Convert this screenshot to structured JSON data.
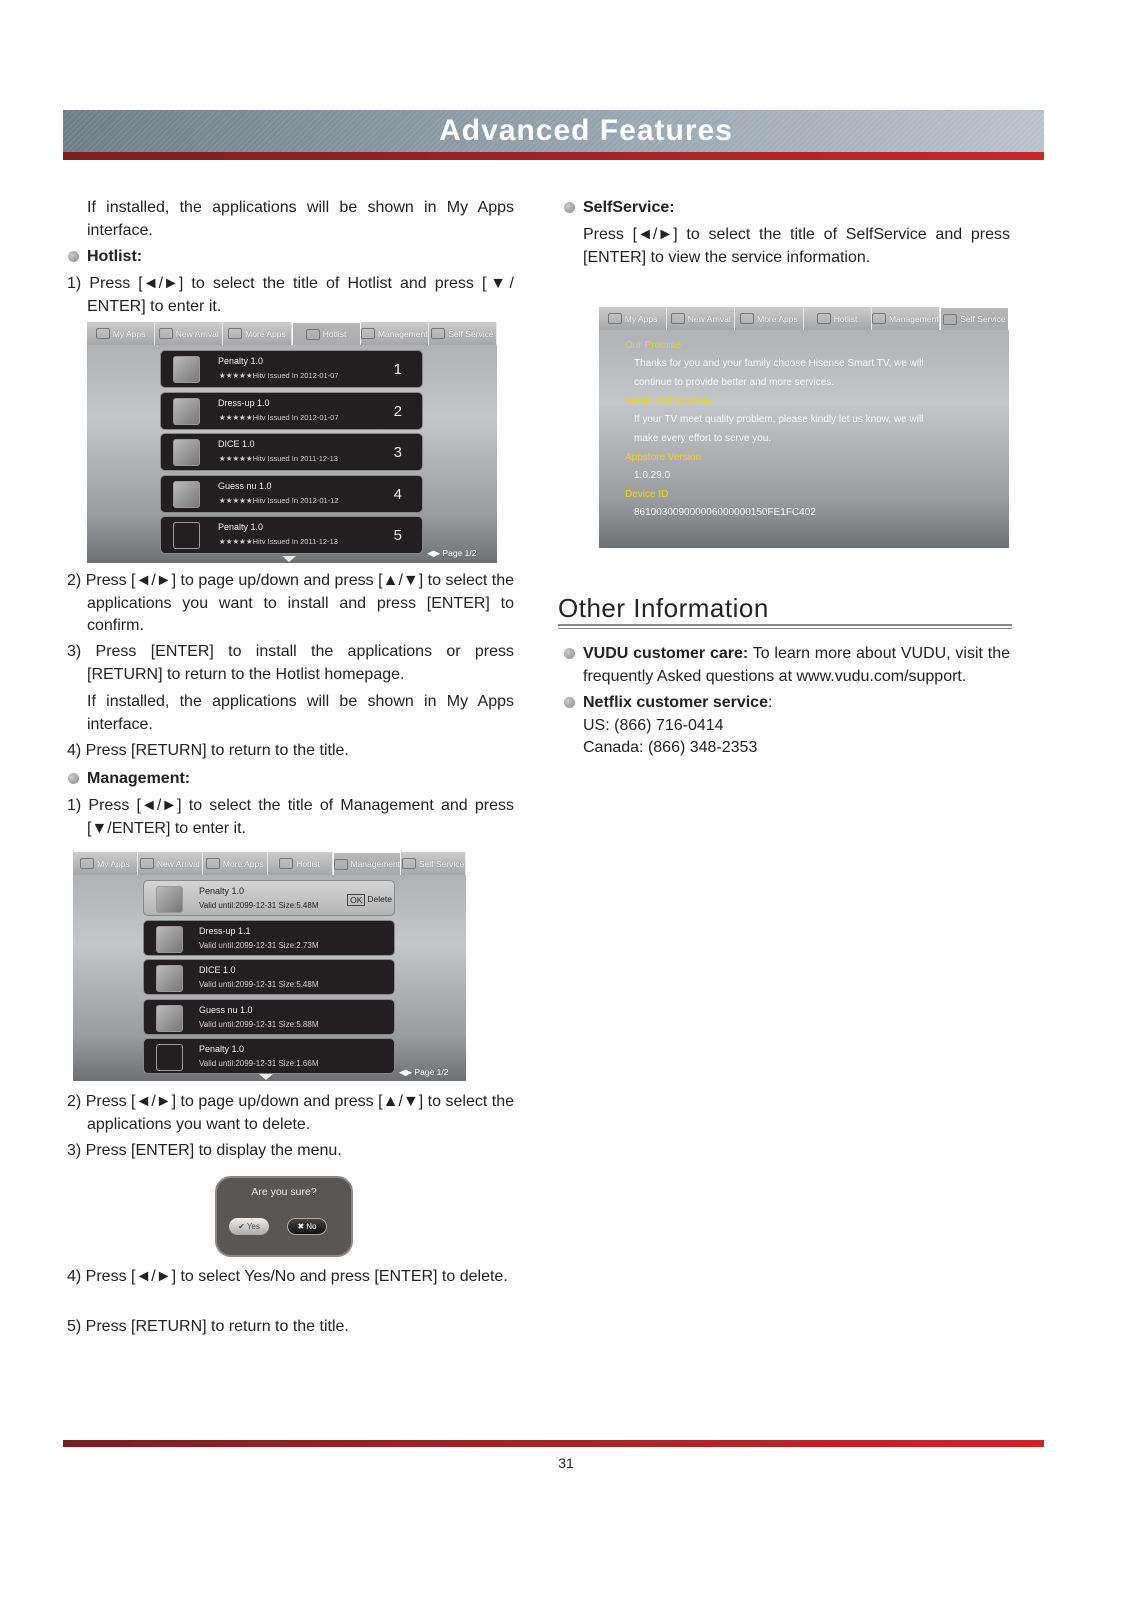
{
  "header": {
    "title": "Advanced Features"
  },
  "left": {
    "intro": "If installed, the applications will be shown in My Apps interface.",
    "hotlist": {
      "heading": "Hotlist:",
      "steps": [
        "1) Press [◄/►] to select the title of Hotlist and press [▼/ ENTER] to enter it.",
        "2) Press [◄/►] to page up/down and press [▲/▼] to select the applications you want to install and press [ENTER] to confirm.",
        "3) Press [ENTER] to install the applications or press [RETURN] to return to the Hotlist homepage.",
        "If installed, the applications will be shown in My Apps interface.",
        "4) Press [RETURN] to return to the title."
      ]
    },
    "management": {
      "heading": "Management:",
      "steps": [
        "1) Press [◄/►] to select the title of Management and press [▼/ENTER] to enter it.",
        "2) Press [◄/►] to page up/down and press [▲/▼] to select the applications you want to delete.",
        "3) Press [ENTER] to display the menu.",
        "4) Press [◄/►] to select Yes/No and press [ENTER] to delete.",
        "5) Press [RETURN] to return to the title."
      ]
    }
  },
  "tabs": [
    "My Apps",
    "New Arrival",
    "More Apps",
    "Hotlist",
    "Management",
    "Self Service"
  ],
  "hotlist_screen": {
    "active_tab": "Hotlist",
    "rows": [
      {
        "title": "Penalty  1.0",
        "sub": "★★★★★Hitv Issued In 2012-01-07",
        "rank": "1"
      },
      {
        "title": "Dress-up  1.0",
        "sub": "★★★★★Hitv Issued In 2012-01-07",
        "rank": "2"
      },
      {
        "title": "DICE  1.0",
        "sub": "★★★★★Hitv Issued In 2011-12-13",
        "rank": "3"
      },
      {
        "title": "Guess nu  1.0",
        "sub": "★★★★★Hitv Issued In 2012-01-12",
        "rank": "4"
      },
      {
        "title": "Penalty  1.0",
        "sub": "★★★★★Hitv Issued In 2011-12-13",
        "rank": "5"
      }
    ],
    "page": "Page  1/2"
  },
  "management_screen": {
    "active_tab": "Management",
    "rows": [
      {
        "title": "Penalty  1.0",
        "sub": "Valid until:2099-12-31 Size:5.48M"
      },
      {
        "title": "Dress-up  1.1",
        "sub": "Valid until:2099-12-31 Size:2.73M"
      },
      {
        "title": "DICE  1.0",
        "sub": "Valid until:2099-12-31 Size:5.48M"
      },
      {
        "title": "Guess nu  1.0",
        "sub": "Valid until:2099-12-31 Size:5.88M"
      },
      {
        "title": "Penalty  1.0",
        "sub": "Valid until:2099-12-31 Size:1.66M"
      }
    ],
    "ok": "OK",
    "delete": "Delete",
    "page": "Page  1/2"
  },
  "dialog": {
    "question": "Are you sure?",
    "yes": "Yes",
    "no": "No"
  },
  "right": {
    "selfservice": {
      "heading": "SelfService:",
      "text": "Press [◄/►] to select the title of SelfService and press [ENTER] to view the service information."
    },
    "other_title": "Other Information",
    "vudu": {
      "label": "VUDU customer care:",
      "text": " To learn more about VUDU, visit the frequently Asked questions at www.vudu.com/support."
    },
    "netflix": {
      "label": "Netflix customer service",
      "colon": ":",
      "us": "US: (866) 716-0414",
      "canada": "Canada: (866) 348-2353"
    }
  },
  "selfservice_screen": {
    "active_tab": "Self Service",
    "promise_h": "Our Promise",
    "promise_1": "Thanks for you and your family choose Hisense Smart TV, we will",
    "promise_2": "continue to provide better and more services.",
    "info_h": "Service Information",
    "info_1": "If your TV meet quality problem, please kindly let us know, we will",
    "info_2": "make every effort to serve you.",
    "version_h": "Appstore Version",
    "version": "1.0.29.0",
    "device_h": "Device ID",
    "device": "861003009000006000000150FE1FC402"
  },
  "footer": {
    "page_number": "31"
  },
  "colors": {
    "accent_red": "#a82326",
    "highlight_yellow": "#f2d21a"
  }
}
